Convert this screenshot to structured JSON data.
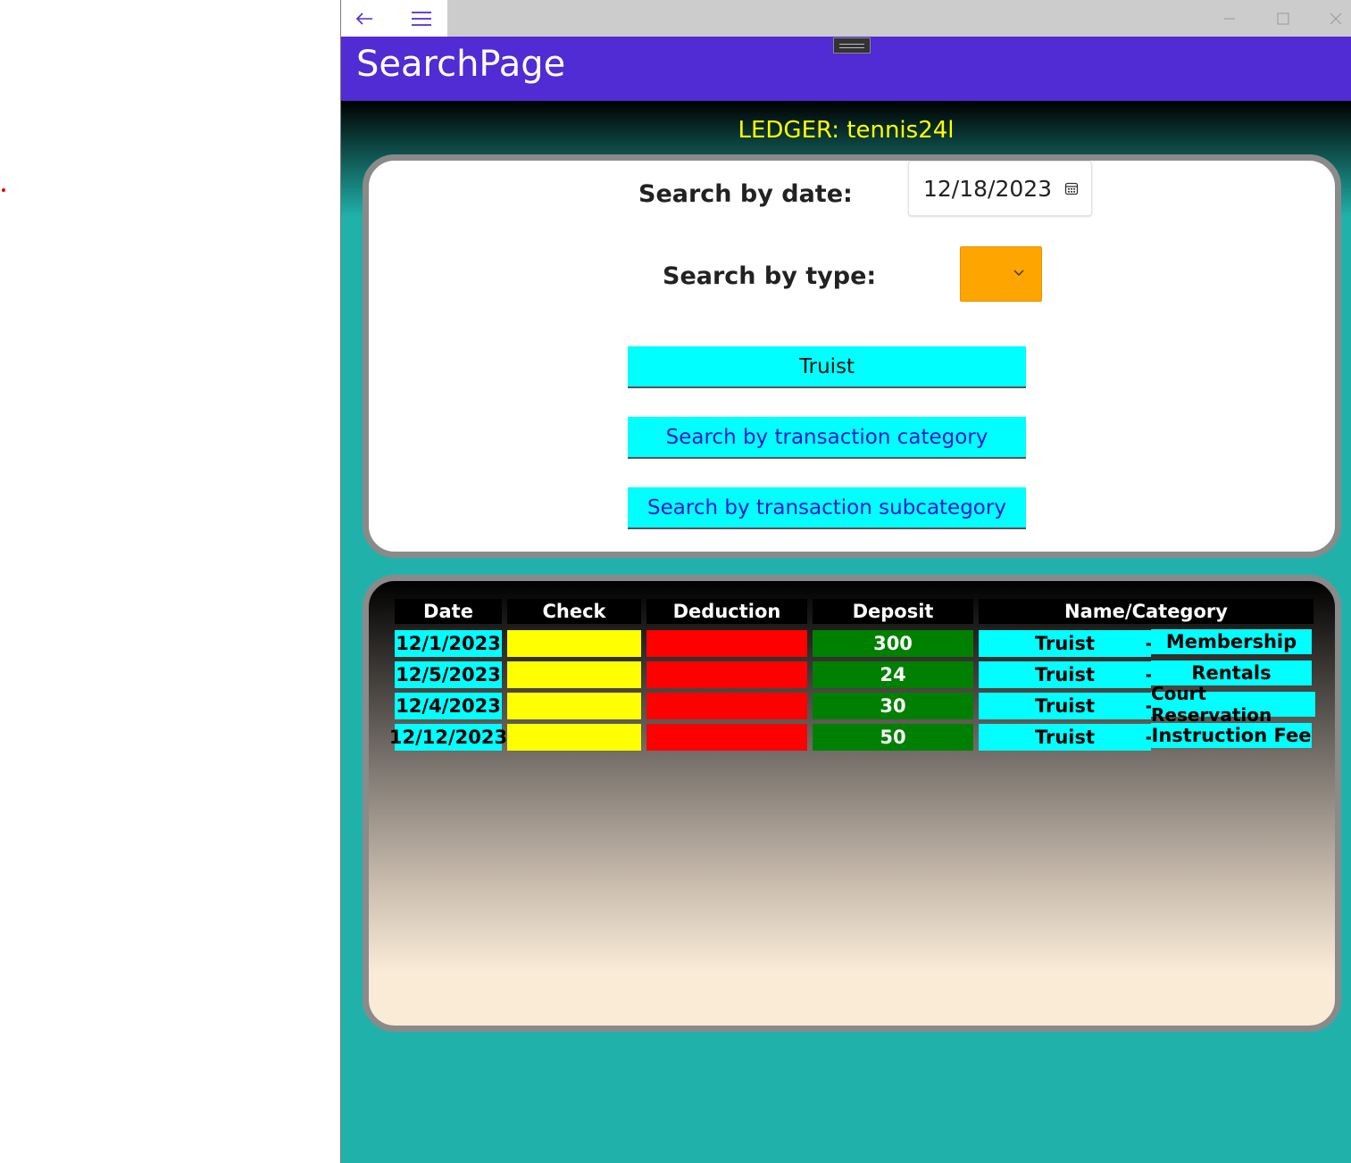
{
  "window": {
    "page_title": "SearchPage",
    "ledger_label": "LEDGER: tennis24l"
  },
  "search": {
    "date_label": "Search by date:",
    "date_value": "12/18/2023",
    "type_label": "Search by type:",
    "type_picker_color": "#FFA500",
    "bank_button": "Truist",
    "category_button": "Search by transaction category",
    "subcategory_button": "Search by transaction subcategory"
  },
  "table": {
    "headers": [
      "Date",
      "Check",
      "Deduction",
      "Deposit",
      "Name/Category"
    ],
    "rows": [
      {
        "date": "12/1/2023",
        "check": "",
        "deduction": "",
        "deposit": "300",
        "name": "Truist",
        "dash": "-",
        "category": "Membership"
      },
      {
        "date": "12/5/2023",
        "check": "",
        "deduction": "",
        "deposit": "24",
        "name": "Truist",
        "dash": "-",
        "category": "Rentals"
      },
      {
        "date": "12/4/2023",
        "check": "",
        "deduction": "",
        "deposit": "30",
        "name": "Truist",
        "dash": "-",
        "category": "Court Reservation"
      },
      {
        "date": "12/12/2023",
        "check": "",
        "deduction": "",
        "deposit": "50",
        "name": "Truist",
        "dash": "-",
        "category": "Instruction Fee"
      }
    ]
  },
  "colors": {
    "app_bar": "#512BD4",
    "page_background": "#20B2AA",
    "ledger_text": "#FFFF00",
    "button_background": "#00FFFF",
    "check_cell": "#FFFF00",
    "deduction_cell": "#FF0000",
    "deposit_cell": "#008000"
  }
}
